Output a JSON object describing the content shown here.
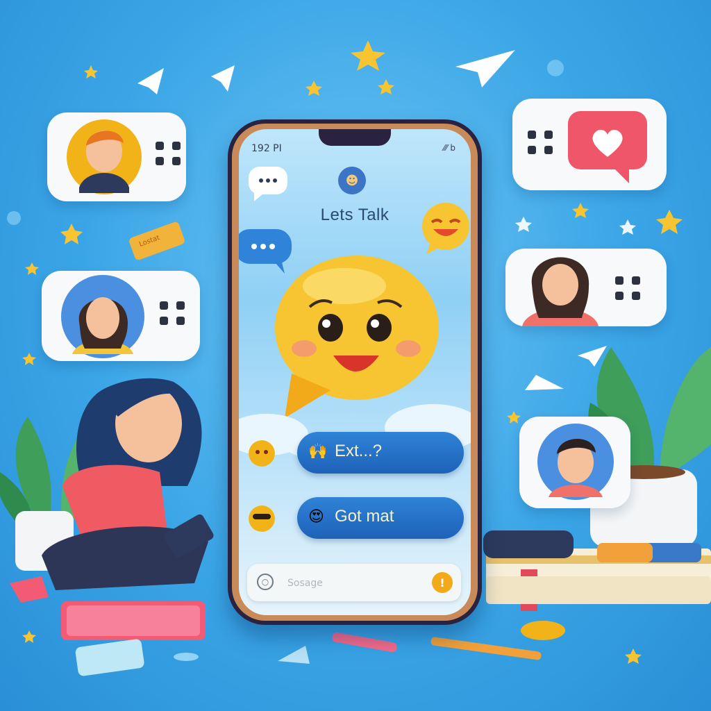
{
  "phone": {
    "status_time": "192 PI",
    "status_icons": "⁄⁄⁄ b",
    "app_icon": "profile-avatar-icon",
    "app_title": "Lets Talk"
  },
  "messages": [
    {
      "emoji": "🙌",
      "text": "Ext...?"
    },
    {
      "emoji": "😍",
      "text": "Got mat"
    }
  ],
  "input": {
    "placeholder": "Sosage",
    "send_icon": "!",
    "attach_icon": "attach-icon"
  },
  "sticker": {
    "text": "Lostat"
  },
  "colors": {
    "background": "#3aa5e6",
    "bubble": "#1d62b8",
    "emoji_yellow": "#f7c531",
    "heart_pink": "#f0566a",
    "send_orange": "#f2a91a"
  }
}
